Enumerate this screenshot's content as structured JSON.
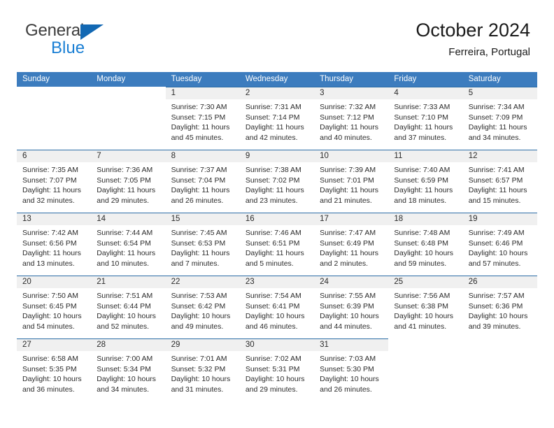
{
  "brand": {
    "name_part1": "General",
    "name_part2": "Blue",
    "accent_color": "#1a7fd4",
    "triangle_color": "#1268b3"
  },
  "header": {
    "title": "October 2024",
    "subtitle": "Ferreira, Portugal"
  },
  "calendar": {
    "header_bg": "#3c7cbe",
    "daynum_bg": "#f0f0f0",
    "row_line_color": "#2b6ca6",
    "weekdays": [
      "Sunday",
      "Monday",
      "Tuesday",
      "Wednesday",
      "Thursday",
      "Friday",
      "Saturday"
    ],
    "weeks": [
      [
        {
          "day": "",
          "lines": []
        },
        {
          "day": "",
          "lines": []
        },
        {
          "day": "1",
          "lines": [
            "Sunrise: 7:30 AM",
            "Sunset: 7:15 PM",
            "Daylight: 11 hours",
            "and 45 minutes."
          ]
        },
        {
          "day": "2",
          "lines": [
            "Sunrise: 7:31 AM",
            "Sunset: 7:14 PM",
            "Daylight: 11 hours",
            "and 42 minutes."
          ]
        },
        {
          "day": "3",
          "lines": [
            "Sunrise: 7:32 AM",
            "Sunset: 7:12 PM",
            "Daylight: 11 hours",
            "and 40 minutes."
          ]
        },
        {
          "day": "4",
          "lines": [
            "Sunrise: 7:33 AM",
            "Sunset: 7:10 PM",
            "Daylight: 11 hours",
            "and 37 minutes."
          ]
        },
        {
          "day": "5",
          "lines": [
            "Sunrise: 7:34 AM",
            "Sunset: 7:09 PM",
            "Daylight: 11 hours",
            "and 34 minutes."
          ]
        }
      ],
      [
        {
          "day": "6",
          "lines": [
            "Sunrise: 7:35 AM",
            "Sunset: 7:07 PM",
            "Daylight: 11 hours",
            "and 32 minutes."
          ]
        },
        {
          "day": "7",
          "lines": [
            "Sunrise: 7:36 AM",
            "Sunset: 7:05 PM",
            "Daylight: 11 hours",
            "and 29 minutes."
          ]
        },
        {
          "day": "8",
          "lines": [
            "Sunrise: 7:37 AM",
            "Sunset: 7:04 PM",
            "Daylight: 11 hours",
            "and 26 minutes."
          ]
        },
        {
          "day": "9",
          "lines": [
            "Sunrise: 7:38 AM",
            "Sunset: 7:02 PM",
            "Daylight: 11 hours",
            "and 23 minutes."
          ]
        },
        {
          "day": "10",
          "lines": [
            "Sunrise: 7:39 AM",
            "Sunset: 7:01 PM",
            "Daylight: 11 hours",
            "and 21 minutes."
          ]
        },
        {
          "day": "11",
          "lines": [
            "Sunrise: 7:40 AM",
            "Sunset: 6:59 PM",
            "Daylight: 11 hours",
            "and 18 minutes."
          ]
        },
        {
          "day": "12",
          "lines": [
            "Sunrise: 7:41 AM",
            "Sunset: 6:57 PM",
            "Daylight: 11 hours",
            "and 15 minutes."
          ]
        }
      ],
      [
        {
          "day": "13",
          "lines": [
            "Sunrise: 7:42 AM",
            "Sunset: 6:56 PM",
            "Daylight: 11 hours",
            "and 13 minutes."
          ]
        },
        {
          "day": "14",
          "lines": [
            "Sunrise: 7:44 AM",
            "Sunset: 6:54 PM",
            "Daylight: 11 hours",
            "and 10 minutes."
          ]
        },
        {
          "day": "15",
          "lines": [
            "Sunrise: 7:45 AM",
            "Sunset: 6:53 PM",
            "Daylight: 11 hours",
            "and 7 minutes."
          ]
        },
        {
          "day": "16",
          "lines": [
            "Sunrise: 7:46 AM",
            "Sunset: 6:51 PM",
            "Daylight: 11 hours",
            "and 5 minutes."
          ]
        },
        {
          "day": "17",
          "lines": [
            "Sunrise: 7:47 AM",
            "Sunset: 6:49 PM",
            "Daylight: 11 hours",
            "and 2 minutes."
          ]
        },
        {
          "day": "18",
          "lines": [
            "Sunrise: 7:48 AM",
            "Sunset: 6:48 PM",
            "Daylight: 10 hours",
            "and 59 minutes."
          ]
        },
        {
          "day": "19",
          "lines": [
            "Sunrise: 7:49 AM",
            "Sunset: 6:46 PM",
            "Daylight: 10 hours",
            "and 57 minutes."
          ]
        }
      ],
      [
        {
          "day": "20",
          "lines": [
            "Sunrise: 7:50 AM",
            "Sunset: 6:45 PM",
            "Daylight: 10 hours",
            "and 54 minutes."
          ]
        },
        {
          "day": "21",
          "lines": [
            "Sunrise: 7:51 AM",
            "Sunset: 6:44 PM",
            "Daylight: 10 hours",
            "and 52 minutes."
          ]
        },
        {
          "day": "22",
          "lines": [
            "Sunrise: 7:53 AM",
            "Sunset: 6:42 PM",
            "Daylight: 10 hours",
            "and 49 minutes."
          ]
        },
        {
          "day": "23",
          "lines": [
            "Sunrise: 7:54 AM",
            "Sunset: 6:41 PM",
            "Daylight: 10 hours",
            "and 46 minutes."
          ]
        },
        {
          "day": "24",
          "lines": [
            "Sunrise: 7:55 AM",
            "Sunset: 6:39 PM",
            "Daylight: 10 hours",
            "and 44 minutes."
          ]
        },
        {
          "day": "25",
          "lines": [
            "Sunrise: 7:56 AM",
            "Sunset: 6:38 PM",
            "Daylight: 10 hours",
            "and 41 minutes."
          ]
        },
        {
          "day": "26",
          "lines": [
            "Sunrise: 7:57 AM",
            "Sunset: 6:36 PM",
            "Daylight: 10 hours",
            "and 39 minutes."
          ]
        }
      ],
      [
        {
          "day": "27",
          "lines": [
            "Sunrise: 6:58 AM",
            "Sunset: 5:35 PM",
            "Daylight: 10 hours",
            "and 36 minutes."
          ]
        },
        {
          "day": "28",
          "lines": [
            "Sunrise: 7:00 AM",
            "Sunset: 5:34 PM",
            "Daylight: 10 hours",
            "and 34 minutes."
          ]
        },
        {
          "day": "29",
          "lines": [
            "Sunrise: 7:01 AM",
            "Sunset: 5:32 PM",
            "Daylight: 10 hours",
            "and 31 minutes."
          ]
        },
        {
          "day": "30",
          "lines": [
            "Sunrise: 7:02 AM",
            "Sunset: 5:31 PM",
            "Daylight: 10 hours",
            "and 29 minutes."
          ]
        },
        {
          "day": "31",
          "lines": [
            "Sunrise: 7:03 AM",
            "Sunset: 5:30 PM",
            "Daylight: 10 hours",
            "and 26 minutes."
          ]
        },
        {
          "day": "",
          "lines": []
        },
        {
          "day": "",
          "lines": []
        }
      ]
    ]
  }
}
